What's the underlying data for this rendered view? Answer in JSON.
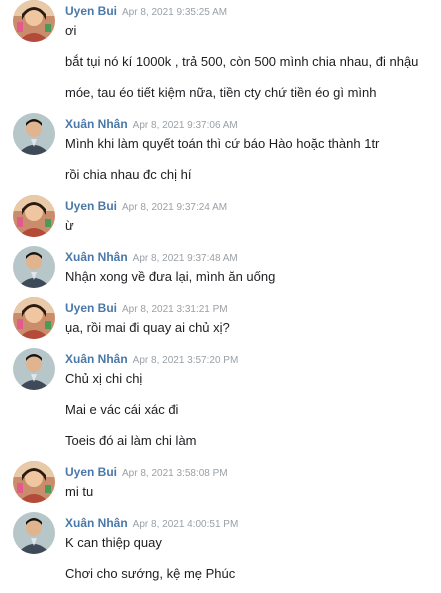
{
  "messages": [
    {
      "sender": "Uyen Bui",
      "avatar": "uyen-avatar",
      "time": "Apr 8, 2021 9:35:25 AM",
      "lines": [
        "ơi",
        "bắt tụi nó kí 1000k , trả 500, còn 500 mình chia nhau, đi nhậu",
        "móe, tau éo tiết kiệm nữa, tiền cty chứ tiền éo gì mình"
      ]
    },
    {
      "sender": "Xuân Nhân",
      "avatar": "nhan-avatar",
      "time": "Apr 8, 2021 9:37:06 AM",
      "lines": [
        "Mình khi làm quyết toán thì cứ báo Hào hoặc thành 1tr",
        "rồi chia nhau đc chị hí"
      ]
    },
    {
      "sender": "Uyen Bui",
      "avatar": "uyen-avatar",
      "time": "Apr 8, 2021 9:37:24 AM",
      "lines": [
        "ừ"
      ]
    },
    {
      "sender": "Xuân Nhân",
      "avatar": "nhan-avatar",
      "time": "Apr 8, 2021 9:37:48 AM",
      "lines": [
        "Nhận xong về đưa lại, mình ăn uống"
      ]
    },
    {
      "sender": "Uyen Bui",
      "avatar": "uyen-avatar",
      "time": "Apr 8, 2021 3:31:21 PM",
      "lines": [
        "ụa, rồi mai đi quay ai chủ xị?"
      ]
    },
    {
      "sender": "Xuân Nhân",
      "avatar": "nhan-avatar",
      "time": "Apr 8, 2021 3:57:20 PM",
      "lines": [
        "Chủ xị chi chị",
        "Mai e vác cái xác đi",
        "Toeis đó ai làm chi làm"
      ]
    },
    {
      "sender": "Uyen Bui",
      "avatar": "uyen-avatar",
      "time": "Apr 8, 2021 3:58:08 PM",
      "lines": [
        "mi tu"
      ]
    },
    {
      "sender": "Xuân Nhân",
      "avatar": "nhan-avatar",
      "time": "Apr 8, 2021 4:00:51 PM",
      "lines": [
        "K can thiệp quay",
        "Chơi cho sướng, kệ mẹ Phúc"
      ]
    }
  ]
}
